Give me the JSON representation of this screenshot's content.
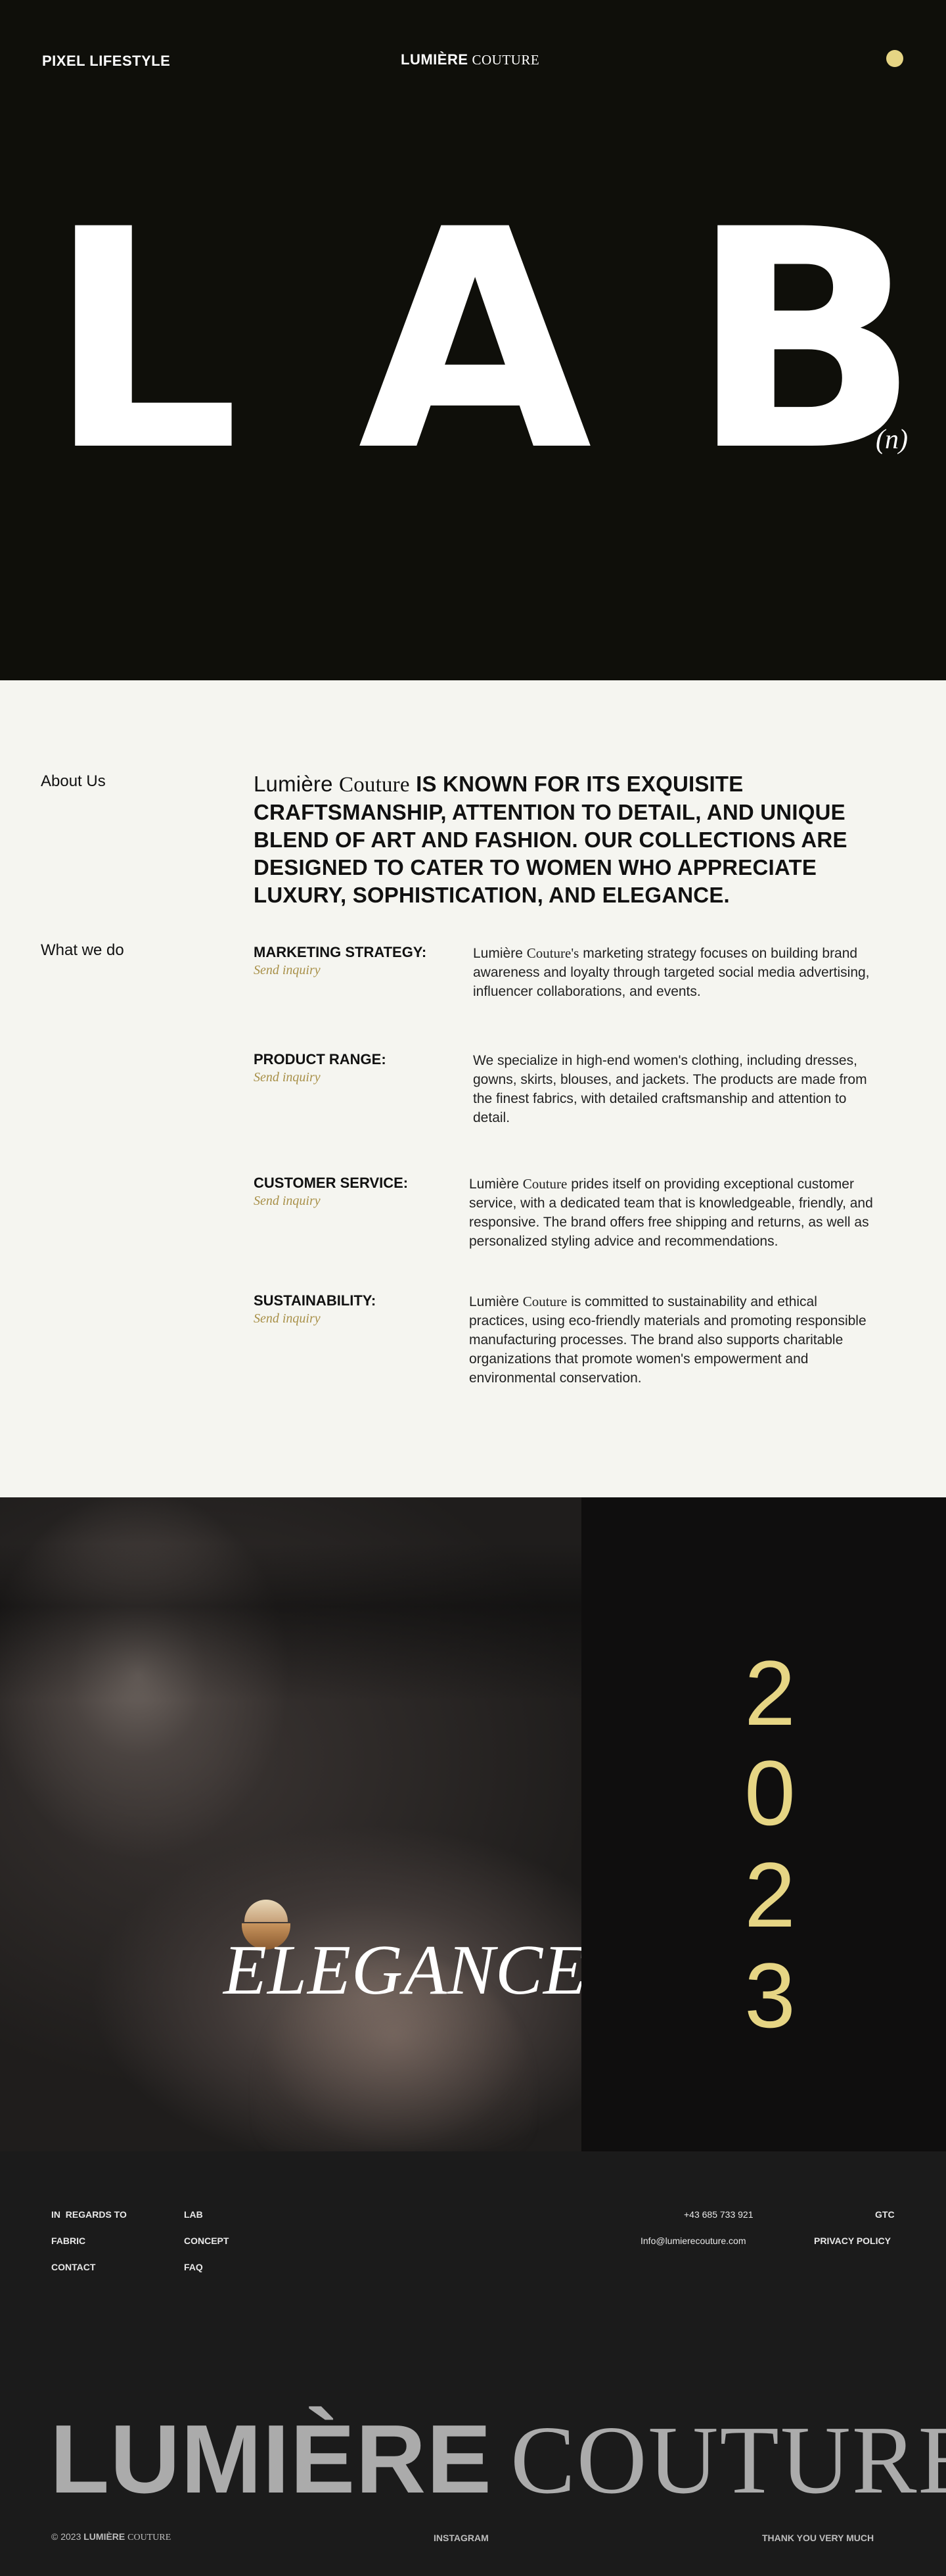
{
  "header": {
    "left_label": "PIXEL LIFESTYLE",
    "brand_bold": "LUMIÈRE",
    "brand_serif": "COUTURE",
    "menu_icon": "circle-dot-icon",
    "accent_color": "#e6d584"
  },
  "hero": {
    "letters": [
      "L",
      "A",
      "B"
    ],
    "superscript": "(n)"
  },
  "about": {
    "about_label": "About Us",
    "statement_brand_a": "Lumière",
    "statement_brand_b": "Couture",
    "statement_text": "IS KNOWN FOR ITS EXQUISITE CRAFTSMANSHIP, ATTENTION TO DETAIL, AND UNIQUE BLEND OF ART AND FASHION. OUR COLLECTIONS ARE DESIGNED TO CATER TO WOMEN WHO APPRECIATE LUXURY, SOPHISTICATION, AND ELEGANCE.",
    "what_label": "What we do",
    "services": [
      {
        "title": "MARKETING STRATEGY:",
        "link": "Send inquiry",
        "brand_a": "Lumière",
        "brand_b": "Couture's",
        "desc": "marketing strategy focuses on building brand awareness and loyalty through targeted social media advertising, influencer collaborations, and events."
      },
      {
        "title": "PRODUCT RANGE:",
        "link": "Send inquiry",
        "desc": "We specialize in high-end women's clothing, including dresses, gowns, skirts, blouses, and jackets. The products are made from the finest fabrics, with detailed craftsmanship and attention to detail."
      },
      {
        "title": "CUSTOMER SERVICE:",
        "link": "Send inquiry",
        "brand_a": "Lumière",
        "brand_b": "Couture",
        "desc": "prides itself on providing exceptional customer service, with a dedicated team that is knowledgeable, friendly, and responsive. The brand offers free shipping and returns, as well as personalized styling advice and recommendations."
      },
      {
        "title": "SUSTAINABILITY:",
        "link": "Send inquiry",
        "brand_a": "Lumière",
        "brand_b": "Couture",
        "desc": "is committed to sustainability and ethical practices, using eco-friendly materials and promoting responsible manufacturing processes. The brand also supports charitable organizations that promote women's empowerment and environmental conservation."
      }
    ]
  },
  "feature": {
    "overlay_text": "ELEGANCE",
    "year_digits": [
      "2",
      "0",
      "2",
      "3"
    ]
  },
  "footer": {
    "col1": [
      "IN  REGARDS TO",
      "FABRIC",
      "CONTACT"
    ],
    "col2": [
      "LAB",
      "CONCEPT",
      "FAQ"
    ],
    "phone": "+43 685 733 921",
    "email": "Info@lumierecouture.com",
    "gtc": "GTC",
    "privacy": "PRIVACY POLICY",
    "big_brand_bold": "LUMIÈRE",
    "big_brand_serif": "COUTURE",
    "copyright_prefix": "© 2023",
    "copyright_bold": "LUMIÈRE",
    "copyright_serif": "COUTURE",
    "instagram": "INSTAGRAM",
    "thanks": "THANK YOU VERY MUCH"
  }
}
